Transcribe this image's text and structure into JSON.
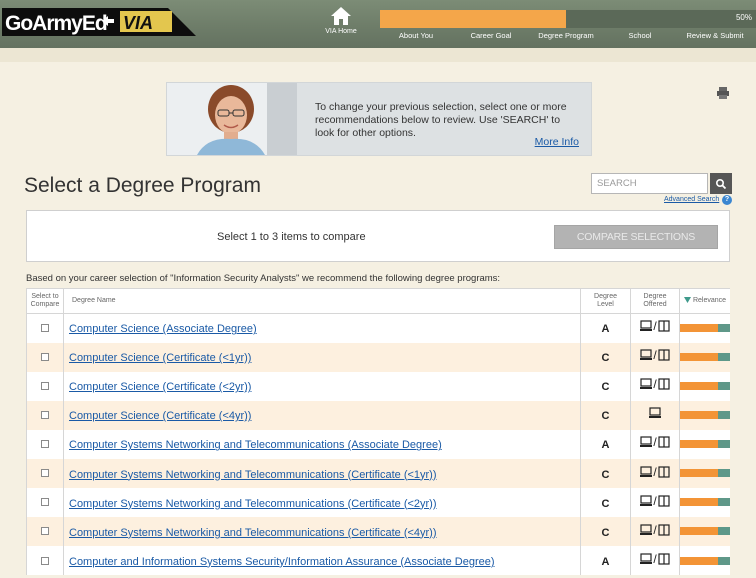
{
  "header": {
    "logo_text": "GoArmyEd-VIA",
    "home_label": "VIA Home",
    "progress_text": "50%",
    "progress_value": 0.5,
    "steps": [
      "About You",
      "Career Goal",
      "Degree Program",
      "School",
      "Review & Submit"
    ]
  },
  "banner": {
    "text": "To change your previous selection, select one or more recommendations below to review. Use 'SEARCH' to look for other options.",
    "link": "More Info"
  },
  "page_title": "Select a Degree Program",
  "search": {
    "placeholder": "SEARCH",
    "advanced_label": "Advanced Search",
    "help_label": "?"
  },
  "compare": {
    "text": "Select 1 to 3 items to compare",
    "button": "COMPARE SELECTIONS"
  },
  "intro": "Based on your career selection of \"Information Security Analysts\" we recommend the following degree programs:",
  "table": {
    "headers": {
      "select_line1": "Select to",
      "select_line2": "Compare",
      "name": "Degree Name",
      "level_line1": "Degree",
      "level_line2": "Level",
      "offered_line1": "Degree",
      "offered_line2": "Offered",
      "relevance": "Relevance"
    },
    "rows": [
      {
        "name": "Computer Science (Associate Degree)",
        "level": "A",
        "offered": "both",
        "relevance": 0.72
      },
      {
        "name": "Computer Science (Certificate (<1yr))",
        "level": "C",
        "offered": "both",
        "relevance": 0.72
      },
      {
        "name": "Computer Science (Certificate (<2yr))",
        "level": "C",
        "offered": "both",
        "relevance": 0.72
      },
      {
        "name": "Computer Science (Certificate (<4yr))",
        "level": "C",
        "offered": "online",
        "relevance": 0.72
      },
      {
        "name": "Computer Systems Networking and Telecommunications (Associate Degree)",
        "level": "A",
        "offered": "both",
        "relevance": 0.72
      },
      {
        "name": "Computer Systems Networking and Telecommunications (Certificate (<1yr))",
        "level": "C",
        "offered": "both",
        "relevance": 0.72
      },
      {
        "name": "Computer Systems Networking and Telecommunications (Certificate (<2yr))",
        "level": "C",
        "offered": "both",
        "relevance": 0.72
      },
      {
        "name": "Computer Systems Networking and Telecommunications (Certificate (<4yr))",
        "level": "C",
        "offered": "both",
        "relevance": 0.72
      },
      {
        "name": "Computer and Information Systems Security/Information Assurance (Associate Degree)",
        "level": "A",
        "offered": "both",
        "relevance": 0.72
      }
    ]
  },
  "colors": {
    "accent_orange": "#f39436",
    "relevance_track": "#5f9889",
    "link_blue": "#1a5aa6",
    "header_green": "#6e7d69"
  }
}
